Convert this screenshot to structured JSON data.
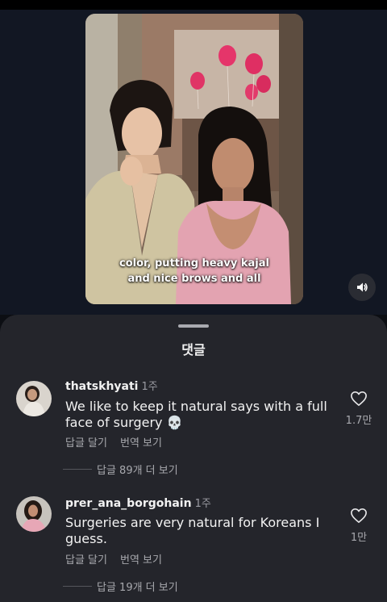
{
  "video": {
    "caption": "color, putting heavy kajal\nand nice brows and all",
    "sound_icon": "speaker-icon"
  },
  "sheet": {
    "title": "댓글"
  },
  "comments": [
    {
      "username": "thatskhyati",
      "time": "1주",
      "text": "We like to keep it natural says with a full face of surgery 💀",
      "reply_label": "답글 달기",
      "translate_label": "번역 보기",
      "likes": "1.7만",
      "view_replies": "답글 89개 더 보기"
    },
    {
      "username": "prer_ana_borgohain",
      "time": "1주",
      "text": "Surgeries are very natural for Koreans I guess.",
      "reply_label": "답글 달기",
      "translate_label": "번역 보기",
      "likes": "1만",
      "view_replies": "답글 19개 더 보기"
    }
  ],
  "colors": {
    "background": "#0c0e13",
    "sheet": "#24252b",
    "secondary_text": "#a8a9ae"
  }
}
